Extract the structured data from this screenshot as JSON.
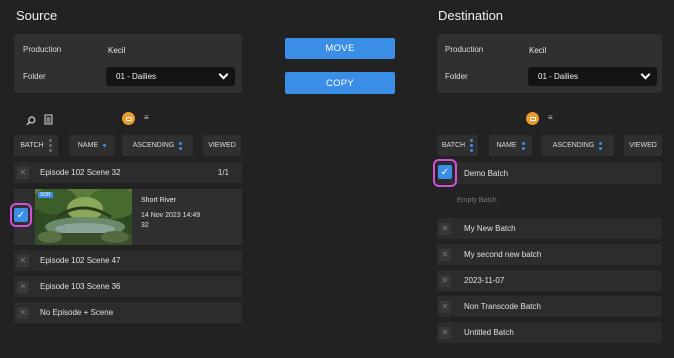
{
  "source": {
    "title": "Source",
    "production_label": "Production",
    "production_value": "Kecil",
    "folder_label": "Folder",
    "folder_value": "01 - Dailies",
    "sort": {
      "batch": "BATCH",
      "name": "NAME",
      "order": "ASCENDING",
      "viewed": "VIEWED"
    },
    "rows": [
      {
        "label": "Episode 102 Scene 32",
        "count": "1/1"
      },
      {
        "label": "Episode 102 Scene 47"
      },
      {
        "label": "Episode 103 Scene 36"
      },
      {
        "label": "No Episode + Scene"
      }
    ],
    "clip": {
      "badge": "SDR",
      "title": "Short River",
      "date": "14 Nov 2023 14:49",
      "num": "32"
    }
  },
  "actions": {
    "move": "MOVE",
    "copy": "COPY"
  },
  "destination": {
    "title": "Destination",
    "production_label": "Production",
    "production_value": "Kecil",
    "folder_label": "Folder",
    "folder_value": "01 - Dailies",
    "sort": {
      "batch": "BATCH",
      "name": "NAME",
      "order": "ASCENDING",
      "viewed": "VIEWED"
    },
    "selected_batch": "Demo Batch",
    "empty_batch": "Empty Batch",
    "batches": [
      "My New Batch",
      "My second new batch",
      "2023-11-07",
      "Non Transcode Batch",
      "Untitled Batch"
    ]
  },
  "colors": {
    "accent": "#3a8ee6",
    "highlight": "#d24fd8",
    "toggle": "#e89a2e"
  }
}
